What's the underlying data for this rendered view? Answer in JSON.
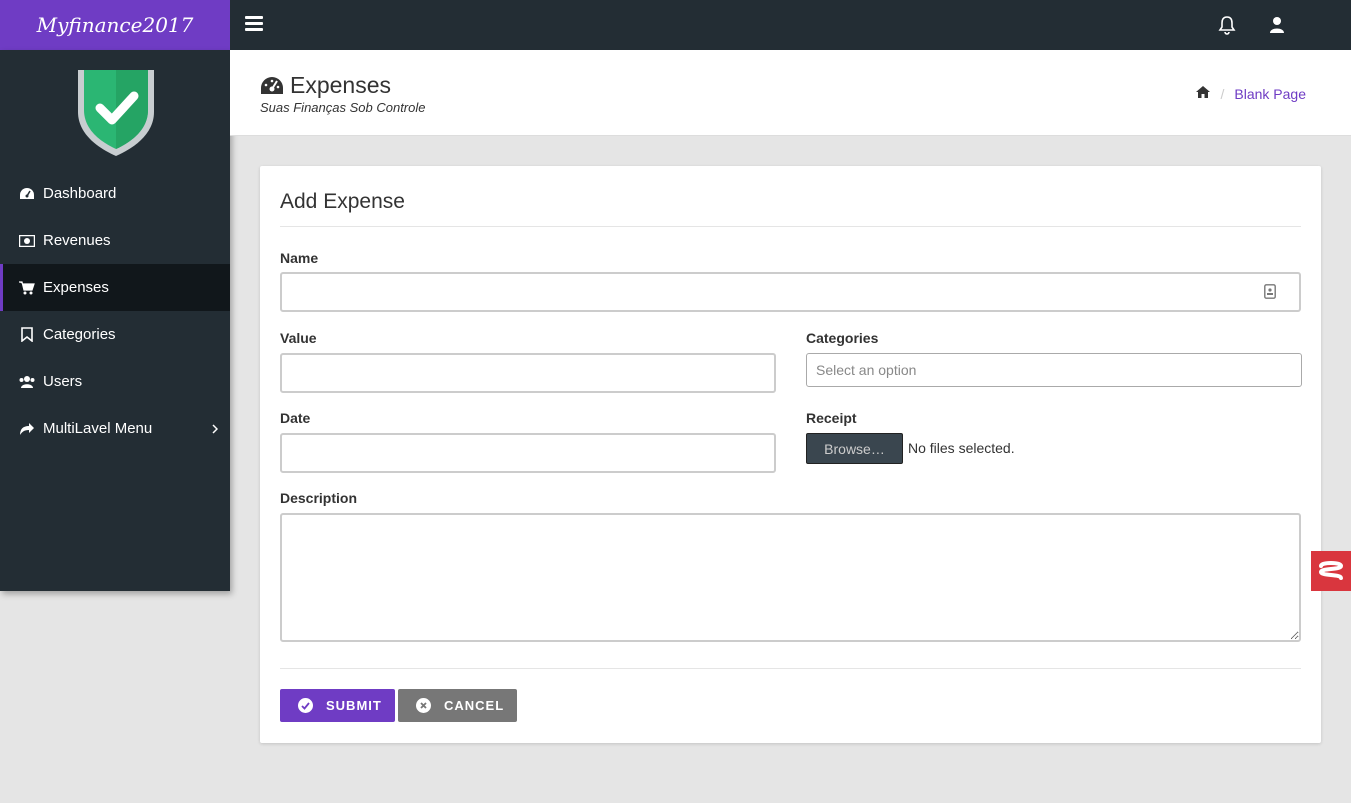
{
  "brand": {
    "name": "Myfinance2017"
  },
  "sidebar": {
    "items": [
      {
        "label": "Dashboard",
        "icon": "dashboard-icon"
      },
      {
        "label": "Revenues",
        "icon": "money-icon"
      },
      {
        "label": "Expenses",
        "icon": "cart-icon",
        "active": true
      },
      {
        "label": "Categories",
        "icon": "bookmark-icon"
      },
      {
        "label": "Users",
        "icon": "users-icon"
      },
      {
        "label": "MultiLavel Menu",
        "icon": "share-icon",
        "has_submenu": true
      }
    ]
  },
  "header": {
    "title": "Expenses",
    "subtitle": "Suas Finanças Sob Controle",
    "breadcrumb": {
      "current": "Blank Page"
    }
  },
  "form": {
    "title": "Add Expense",
    "name": {
      "label": "Name",
      "value": ""
    },
    "value": {
      "label": "Value",
      "value": ""
    },
    "categories": {
      "label": "Categories",
      "placeholder": "Select an option"
    },
    "date": {
      "label": "Date",
      "value": ""
    },
    "receipt": {
      "label": "Receipt",
      "button": "Browse…",
      "status": "No files selected."
    },
    "description": {
      "label": "Description",
      "value": ""
    },
    "submit_label": "SUBMIT",
    "cancel_label": "CANCEL"
  },
  "colors": {
    "accent": "#6f3cc4",
    "sidebar_bg": "#232d34",
    "cancel": "#777777",
    "widget": "#d9363e"
  }
}
